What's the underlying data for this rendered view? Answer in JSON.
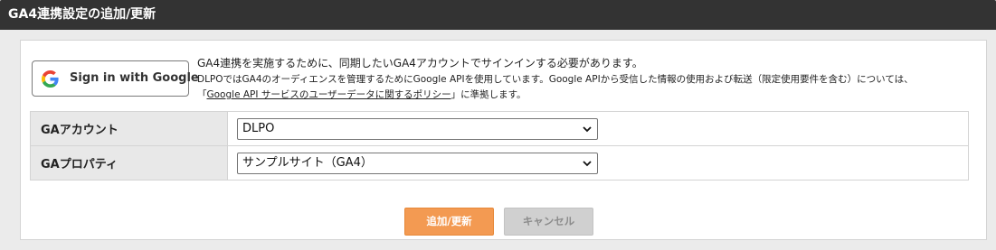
{
  "header": {
    "title": "GA4連携設定の追加/更新"
  },
  "google_signin": {
    "label": "Sign in with Google",
    "icon": "google-g-icon",
    "colors": {
      "blue": "#4285F4",
      "red": "#EA4335",
      "yellow": "#FBBC05",
      "green": "#34A853"
    }
  },
  "notice": {
    "main": "GA4連携を実施するために、同期したいGA4アカウントでサインインする必要があります。",
    "sub_line1": "DLPOではGA4のオーディエンスを管理するためにGoogle APIを使用しています。Google APIから受信した情報の使用および転送（限定使用要件を含む）については、",
    "sub_line2_prefix": "「",
    "policy_link": "Google API サービスのユーザーデータに関するポリシー",
    "sub_line2_suffix": "」に準拠します。"
  },
  "form": {
    "rows": [
      {
        "label": "GAアカウント",
        "selected": "DLPO"
      },
      {
        "label": "GAプロパティ",
        "selected": "サンプルサイト（GA4）"
      }
    ]
  },
  "actions": {
    "submit_label": "追加/更新",
    "cancel_label": "キャンセル"
  },
  "colors": {
    "header_bg": "#333333",
    "submit_bg": "#f39a52",
    "cancel_bg": "#d0d0d0"
  }
}
